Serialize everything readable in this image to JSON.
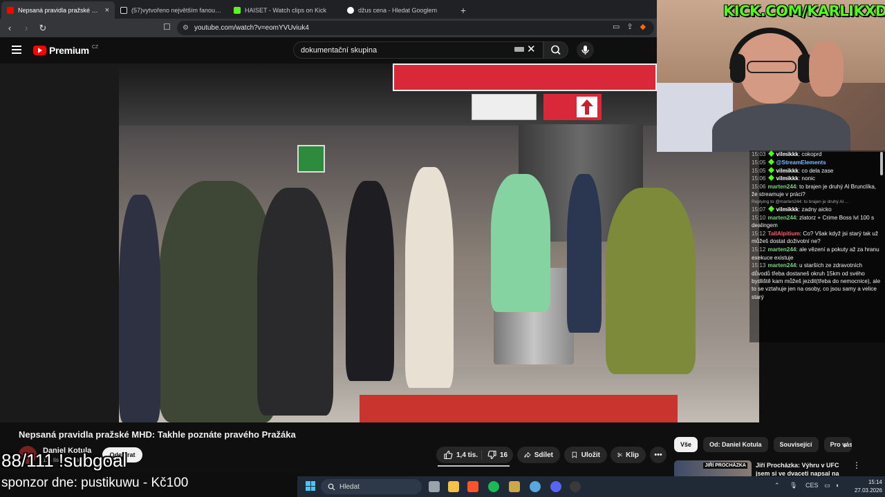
{
  "browser": {
    "tabs": [
      {
        "label": "Nepsaná pravidla pražské MHD",
        "color": "#ff0000",
        "active": true
      },
      {
        "label": "(57)vytvořeno největším fanouškem",
        "color": "#111111",
        "active": false
      },
      {
        "label": "HAISET - Watch clips on Kick",
        "color": "#53fc18",
        "active": false
      },
      {
        "label": "džus cena - Hledat Googlem",
        "color": "#4285f4",
        "active": false
      }
    ],
    "tab_close": "×",
    "new_tab": "+",
    "url": "youtube.com/watch?v=eomYVUviuk4"
  },
  "youtube": {
    "logo_text": "Premium",
    "logo_region": "CZ",
    "search_value": "dokumentační skupina",
    "clear": "✕"
  },
  "video": {
    "title": "Nepsaná pravidla pražské MHD: Takhle poznáte pravého Pražáka",
    "channel": "Daniel Kotula",
    "subscribers": "115 tis. odběratelů",
    "subscribe_label": "Odebírat",
    "likes": "1,4 tis.",
    "dislikes": "16",
    "share_label": "Sdílet",
    "save_label": "Uložit",
    "clip_label": "Klip",
    "more": "•••"
  },
  "chips": [
    "Vše",
    "Od: Daniel Kotula",
    "Související",
    "Pro vás"
  ],
  "recommendation": {
    "title": "Jiří Procházka: Výhru v UFC jsem si ve dvaceti napsal na",
    "thumb_text": "JIŘÍ PROCHÁZKA"
  },
  "stream": {
    "kick_url": "KICK.COM/KARLIKXD",
    "subgoal": "88/111 !subgoal",
    "sponzor": "sponzor dne: pustikuwu - Kč100"
  },
  "chat": [
    {
      "time": "15:03",
      "user": "vilmikkk",
      "user_color": "#ffffff",
      "text": "cokoprd",
      "badge": true
    },
    {
      "time": "15:05",
      "user": "@StreamElements",
      "user_color": "#7fb8ff",
      "text": "",
      "badge": true
    },
    {
      "time": "15:05",
      "user": "vilmikkk",
      "user_color": "#ffffff",
      "text": "co dela zase",
      "badge": true
    },
    {
      "time": "15:06",
      "user": "vilmikkk",
      "user_color": "#ffffff",
      "text": "nonic",
      "badge": true
    },
    {
      "time": "15:06",
      "user": "marten244",
      "user_color": "#7cd17c",
      "text": "to brajen je druhý Al Brunclíka, že streamuje v práci?",
      "badge": false
    },
    {
      "reply": "Replying to @marten244: to brajen je druhý Al ..."
    },
    {
      "time": "15:07",
      "user": "vilmikkk",
      "user_color": "#ffffff",
      "text": "zadny aicko",
      "badge": true
    },
    {
      "time": "15:10",
      "user": "marten244",
      "user_color": "#7cd17c",
      "text": "zlatorz + Crime Boss lvl 100 s dealingem",
      "badge": false
    },
    {
      "time": "15:12",
      "user": "TallAlpitium",
      "user_color": "#ff5a6e",
      "text": "Co? Však když jsi starý tak už můžeš dostat doživotní ne?",
      "badge": false
    },
    {
      "time": "15:12",
      "user": "marten244",
      "user_color": "#7cd17c",
      "text": "ale vězení a pokuty až za hranu exekuce existuje",
      "badge": false
    },
    {
      "time": "15:13",
      "user": "marten244",
      "user_color": "#7cd17c",
      "text": "u starších ze zdravotních důvodů třeba dostaneš okruh 15km od svého bydliště kam můžeš jezdit(třeba do nemocnice), ale to se vztahuje jen na osoby, co jsou samy a velice starý",
      "badge": false
    }
  ],
  "taskbar": {
    "search_placeholder": "Hledat",
    "language": "CES",
    "time": "15:14",
    "date": "27.03.2026"
  }
}
